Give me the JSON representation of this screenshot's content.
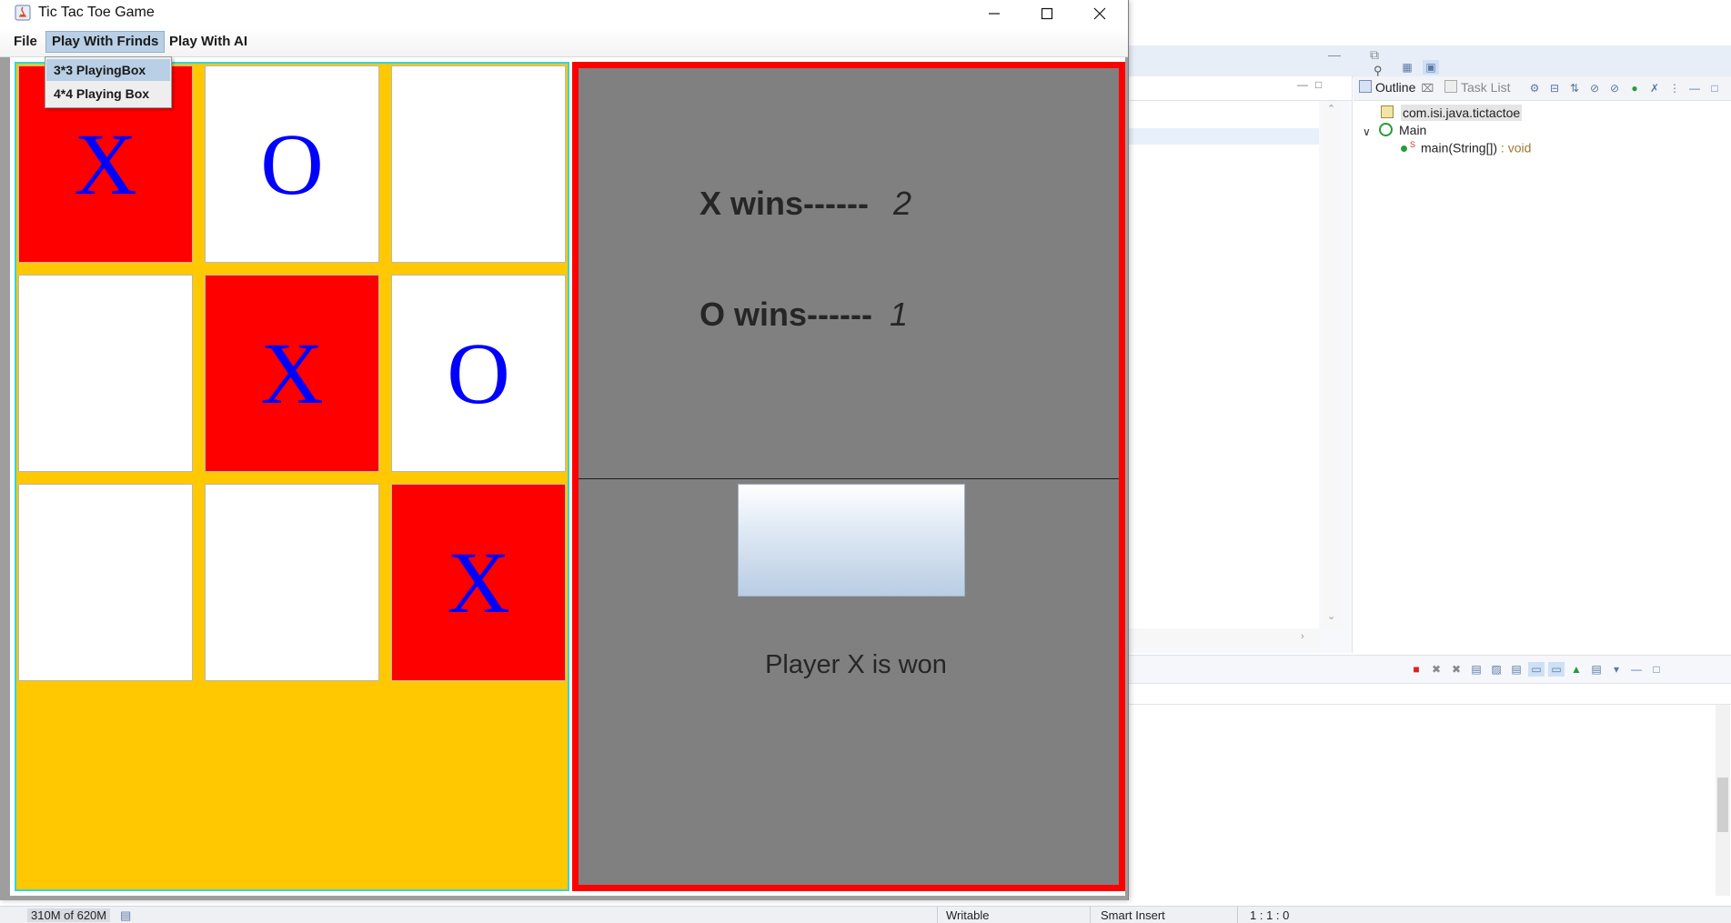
{
  "window": {
    "title": "Tic Tac Toe Game"
  },
  "menu": {
    "items": [
      {
        "label": "File"
      },
      {
        "label": "Play With Frinds"
      },
      {
        "label": "Play With AI"
      }
    ],
    "dropdown": [
      {
        "label": "3*3 PlayingBox",
        "highlighted": true
      },
      {
        "label": "4*4 Playing Box",
        "highlighted": false
      }
    ]
  },
  "board": {
    "cells": [
      {
        "mark": "X",
        "winning": true
      },
      {
        "mark": "O",
        "winning": false
      },
      {
        "mark": "",
        "winning": false
      },
      {
        "mark": "",
        "winning": false
      },
      {
        "mark": "X",
        "winning": true
      },
      {
        "mark": "O",
        "winning": false
      },
      {
        "mark": "",
        "winning": false
      },
      {
        "mark": "",
        "winning": false
      },
      {
        "mark": "X",
        "winning": true
      }
    ],
    "colors": {
      "background": "#ffc800",
      "win_cell": "#ff0000",
      "mark": "#0000ff"
    }
  },
  "scores": {
    "x_label": "X wins------",
    "x_value": "2",
    "o_label": "O wins------",
    "o_value": "1"
  },
  "result": {
    "text": "Player X is won"
  },
  "ide": {
    "outline": {
      "tab_outline": "Outline",
      "tab_tasklist": "Task List",
      "package": "com.isi.java.tictactoe",
      "class": "Main",
      "method": "main(String[])",
      "method_type": " : void"
    },
    "status": {
      "memory": "310M of 620M",
      "writable": "Writable",
      "insert_mode": "Smart Insert",
      "position": "1 : 1 : 0"
    }
  }
}
